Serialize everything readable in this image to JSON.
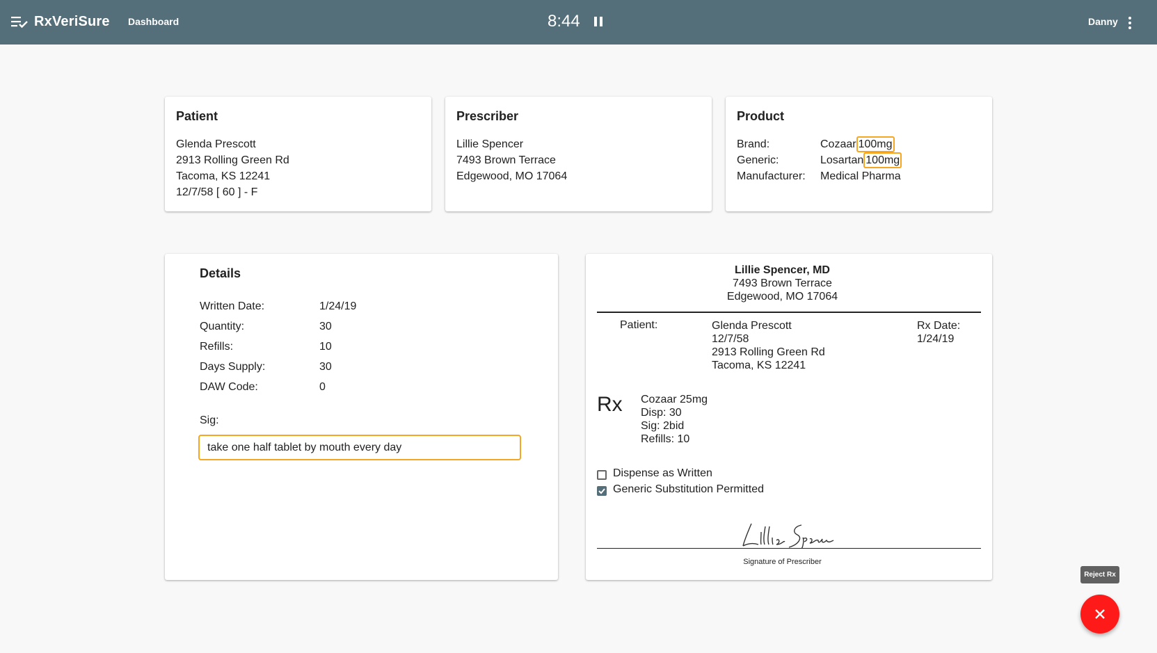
{
  "topbar": {
    "app_name": "RxVeriSure",
    "nav_dashboard": "Dashboard",
    "timer": "8:44",
    "user": "Danny",
    "color": "#546e7a"
  },
  "patient_card": {
    "title": "Patient",
    "name": "Glenda Prescott",
    "address1": "2913 Rolling Green Rd",
    "address2": "Tacoma, KS 12241",
    "dob_line": "12/7/58 [ 60 ] - F"
  },
  "prescriber_card": {
    "title": "Prescriber",
    "name": "Lillie Spencer",
    "address1": "7493 Brown Terrace",
    "address2": "Edgewood, MO 17064"
  },
  "product_card": {
    "title": "Product",
    "brand_label": "Brand:",
    "brand_name": "Cozaar",
    "brand_strength": "100mg",
    "generic_label": "Generic:",
    "generic_name": "Losartan",
    "generic_strength": "100mg",
    "manufacturer_label": "Manufacturer:",
    "manufacturer": "Medical Pharma",
    "highlight_color": "#f5a623"
  },
  "details_card": {
    "title": "Details",
    "rows": [
      {
        "label": "Written Date:",
        "value": "1/24/19"
      },
      {
        "label": "Quantity:",
        "value": "30"
      },
      {
        "label": "Refills:",
        "value": "10"
      },
      {
        "label": "Days Supply:",
        "value": "30"
      },
      {
        "label": "DAW Code:",
        "value": "0"
      }
    ],
    "sig_label": "Sig:",
    "sig_value": "take one half tablet by mouth every day"
  },
  "rx_card": {
    "prescriber_name": "Lillie Spencer, MD",
    "prescriber_address1": "7493 Brown Terrace",
    "prescriber_address2": "Edgewood, MO 17064",
    "patient_label": "Patient:",
    "patient_name": "Glenda Prescott",
    "patient_dob": "12/7/58",
    "patient_address1": "2913 Rolling Green Rd",
    "patient_address2": "Tacoma, KS 12241",
    "rx_date_label": "Rx Date:",
    "rx_date": "1/24/19",
    "rx_symbol": "Rx",
    "drug": "Cozaar 25mg",
    "disp": "Disp: 30",
    "sig": "Sig: 2bid",
    "refills": "Refills: 10",
    "dispense_as_written_label": "Dispense as Written",
    "dispense_as_written_checked": false,
    "generic_sub_label": "Generic Substitution Permitted",
    "generic_sub_checked": true,
    "signature": "Lillie Spencer",
    "signature_caption": "Signature of Prescriber"
  },
  "reject": {
    "tooltip": "Reject Rx",
    "color": "#ff1a1a"
  }
}
